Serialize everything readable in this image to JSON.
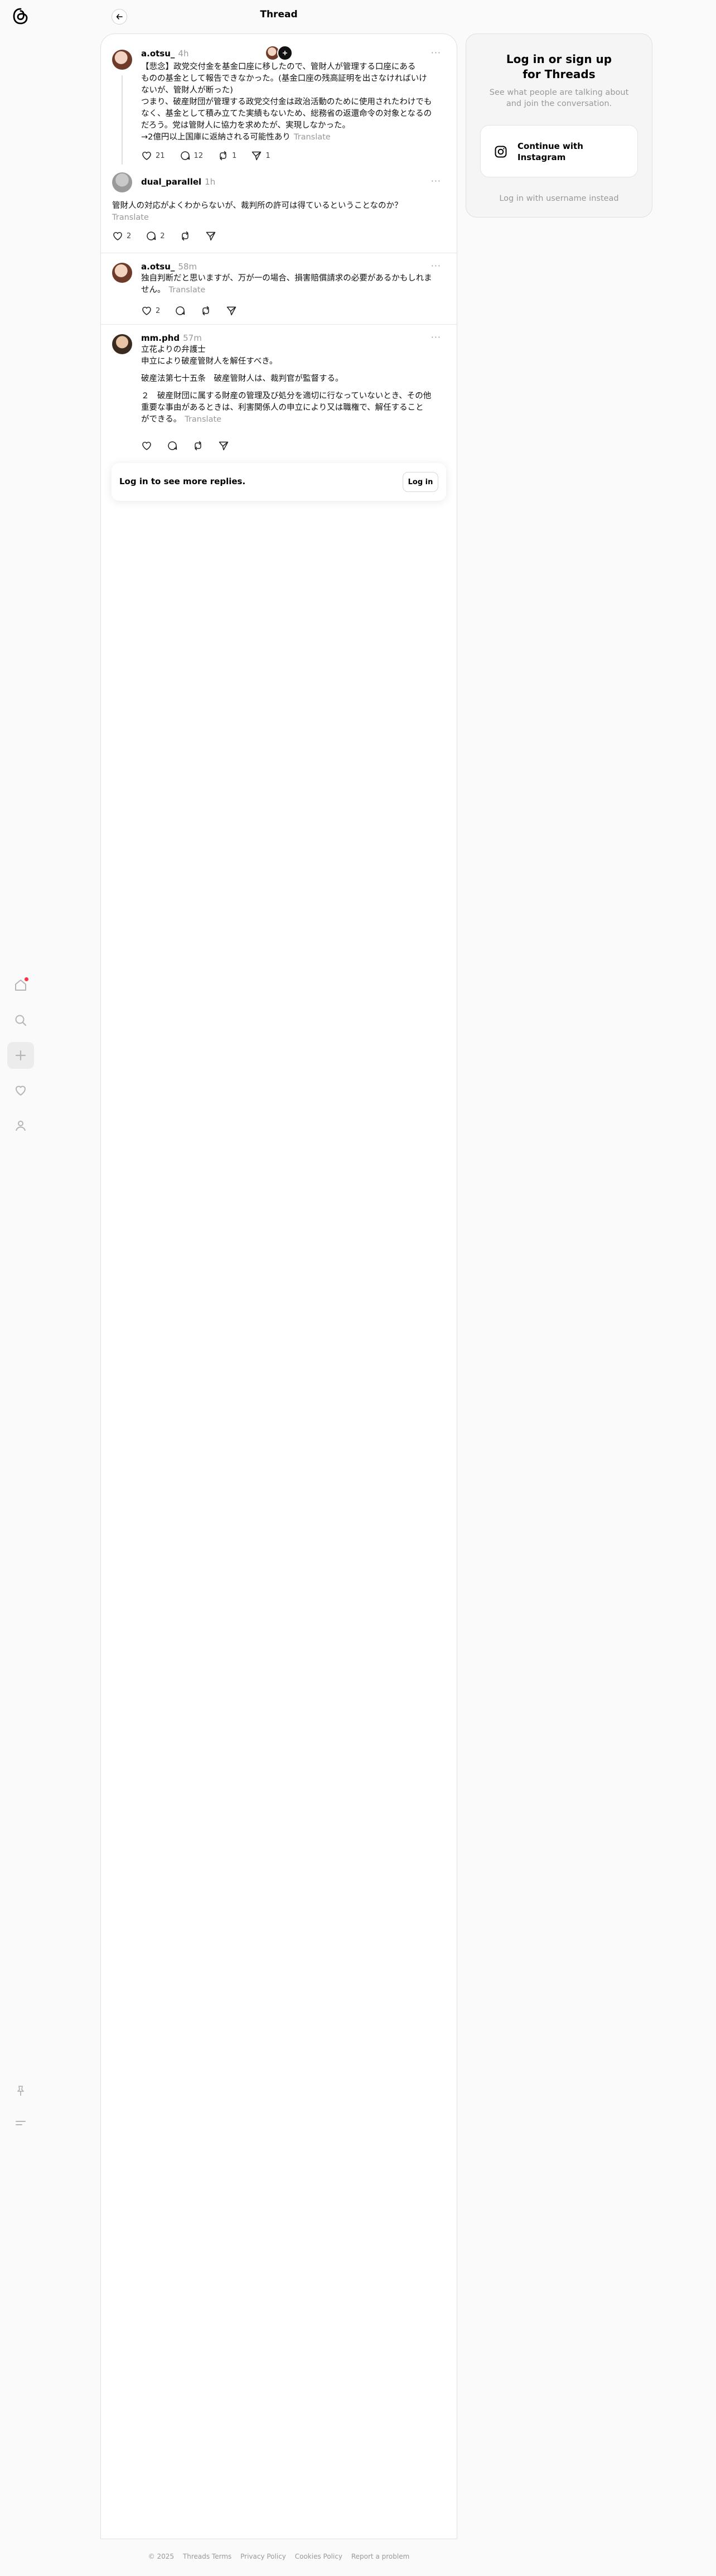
{
  "header": {
    "title": "Thread"
  },
  "nav": {
    "items": [
      {
        "name": "home-icon"
      },
      {
        "name": "search-icon"
      },
      {
        "name": "create-icon"
      },
      {
        "name": "heart-icon"
      },
      {
        "name": "profile-icon"
      },
      {
        "name": "pin-icon"
      },
      {
        "name": "menu-icon"
      }
    ]
  },
  "posts": [
    {
      "username": "a.otsu_",
      "time": "4h",
      "lines": [
        "【悲念】政党交付金を基金口座に移したので、管財人が管理する口座にある",
        "ものの基金として報告できなかった。(基金口座の残高証明を出さなければいけ",
        "ないが、管財人が断った)",
        "つまり、破産財団が管理する政党交付金は政治活動のために使用されたわけでも",
        "なく、基金として積み立てた実績もないため、総務省の返還命令の対象となるの",
        "だろう。党は管財人に協力を求めたが、実現しなかった。",
        "→2億円以上国庫に返納される可能性あり"
      ],
      "translate": "Translate",
      "likes": "21",
      "replies": "12",
      "reposts": "1",
      "shares": "1"
    },
    {
      "username": "dual_parallel",
      "time": "1h",
      "text": "管財人の対応がよくわからないが、裁判所の許可は得ているということなのか？",
      "translate": "Translate",
      "likes": "2",
      "replies": "2"
    },
    {
      "username": "a.otsu_",
      "time": "58m",
      "lines": [
        "独自判断だと思いますが、万が一の場合、損害賠償請求の必要があるかもしれま",
        "せん。"
      ],
      "translate": "Translate",
      "likes": "2"
    },
    {
      "username": "mm.phd",
      "time": "57m",
      "para1": [
        "立花よりの弁護士",
        "申立により破産管財人を解任すべき。"
      ],
      "para2": [
        "破産法第七十五条　破産管財人は、裁判官が監督する。"
      ],
      "para3": [
        "２　破産財団に属する財産の管理及び処分を適切に行なっていないとき、その他",
        "重要な事由があるときは、利害関係人の申立により又は職権で、解任すること",
        "ができる。"
      ],
      "translate": "Translate"
    }
  ],
  "login_card": {
    "text": "Log in to see more replies.",
    "button": "Log in"
  },
  "sidebar": {
    "title_line1": "Log in or sign up",
    "title_line2": "for Threads",
    "subtitle_line1": "See what people are talking about",
    "subtitle_line2": "and join the conversation.",
    "ig_line1": "Continue with",
    "ig_line2": "Instagram",
    "username_link": "Log in with username instead"
  },
  "footer": {
    "links": [
      "© 2025",
      "Threads Terms",
      "Privacy Policy",
      "Cookies Policy",
      "Report a problem"
    ]
  }
}
